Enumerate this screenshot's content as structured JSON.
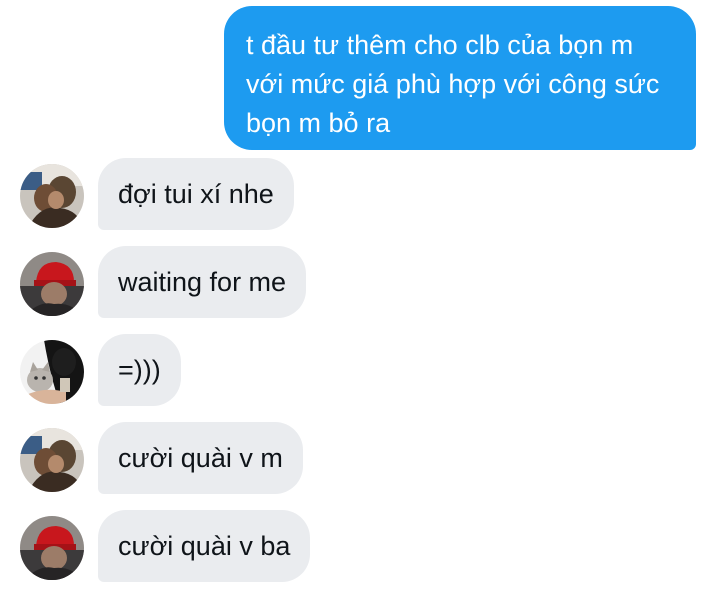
{
  "outgoing": {
    "text": "t đầu tư thêm cho clb của bọn m với mức giá phù hợp với công sức bọn m bỏ ra"
  },
  "messages": [
    {
      "text": "đợi tui xí nhe",
      "avatar": "avatar-couple-photo"
    },
    {
      "text": "waiting for me",
      "avatar": "avatar-red-cap-photo"
    },
    {
      "text": "=)))",
      "avatar": "avatar-person-with-cat-photo"
    },
    {
      "text": "cười quài v m",
      "avatar": "avatar-couple-photo"
    },
    {
      "text": "cười quài v ba",
      "avatar": "avatar-red-cap-photo"
    }
  ],
  "colors": {
    "outgoing_bubble": "#1d9bf0",
    "incoming_bubble": "#eaecef",
    "incoming_text": "#0f1419",
    "outgoing_text": "#ffffff"
  }
}
